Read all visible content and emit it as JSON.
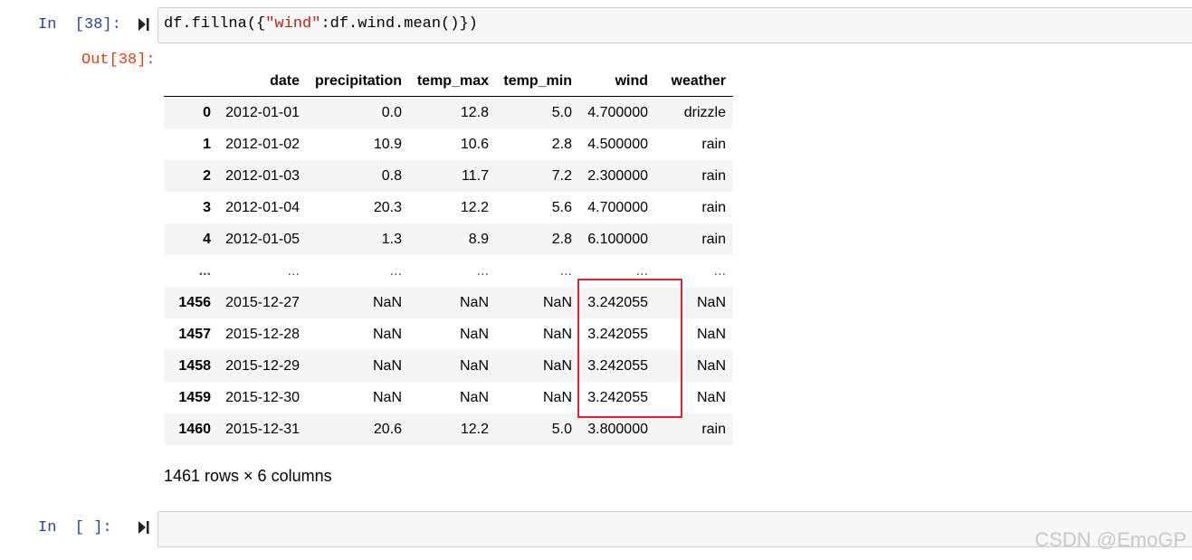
{
  "cell1": {
    "in_prompt": "In  [38]:",
    "code_parts": [
      "df.fillna({",
      "\"wind\"",
      ":df.wind.mean()})"
    ],
    "out_prompt": "Out[38]:"
  },
  "dataframe": {
    "columns": [
      "",
      "date",
      "precipitation",
      "temp_max",
      "temp_min",
      "wind",
      "weather"
    ],
    "rows": [
      [
        "0",
        "2012-01-01",
        "0.0",
        "12.8",
        "5.0",
        "4.700000",
        "drizzle"
      ],
      [
        "1",
        "2012-01-02",
        "10.9",
        "10.6",
        "2.8",
        "4.500000",
        "rain"
      ],
      [
        "2",
        "2012-01-03",
        "0.8",
        "11.7",
        "7.2",
        "2.300000",
        "rain"
      ],
      [
        "3",
        "2012-01-04",
        "20.3",
        "12.2",
        "5.6",
        "4.700000",
        "rain"
      ],
      [
        "4",
        "2012-01-05",
        "1.3",
        "8.9",
        "2.8",
        "6.100000",
        "rain"
      ],
      [
        "...",
        "...",
        "...",
        "...",
        "...",
        "...",
        "..."
      ],
      [
        "1456",
        "2015-12-27",
        "NaN",
        "NaN",
        "NaN",
        "3.242055",
        "NaN"
      ],
      [
        "1457",
        "2015-12-28",
        "NaN",
        "NaN",
        "NaN",
        "3.242055",
        "NaN"
      ],
      [
        "1458",
        "2015-12-29",
        "NaN",
        "NaN",
        "NaN",
        "3.242055",
        "NaN"
      ],
      [
        "1459",
        "2015-12-30",
        "NaN",
        "NaN",
        "NaN",
        "3.242055",
        "NaN"
      ],
      [
        "1460",
        "2015-12-31",
        "20.6",
        "12.2",
        "5.0",
        "3.800000",
        "rain"
      ]
    ],
    "summary": "1461 rows × 6 columns"
  },
  "cell2": {
    "in_prompt": "In  [ ]:",
    "code": ""
  },
  "watermark": "CSDN @EmoGP",
  "colors": {
    "in_prompt": "#303f9f",
    "out_prompt": "#d84315",
    "string": "#ba2121",
    "highlight": "#d9232d"
  }
}
